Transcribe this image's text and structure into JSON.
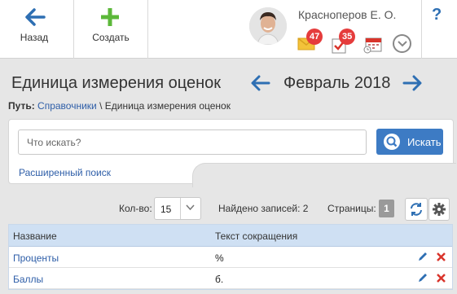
{
  "toolbar": {
    "back_label": "Назад",
    "create_label": "Создать",
    "back_icon": "arrow-left-icon",
    "create_icon": "plus-icon",
    "help_label": "?"
  },
  "user": {
    "name": "Красноперов Е. О.",
    "mail_count": "47",
    "task_count": "35"
  },
  "header": {
    "title": "Единица измерения оценок",
    "period": "Февраль 2018"
  },
  "breadcrumb": {
    "prefix": "Путь:",
    "link": "Справочники",
    "separator": " \\ ",
    "current": "Единица измерения оценок"
  },
  "search": {
    "placeholder": "Что искать?",
    "button_label": "Искать",
    "advanced_label": "Расширенный поиск"
  },
  "pager": {
    "count_label": "Кол-во:",
    "count_value": "15",
    "found_label": "Найдено записей:",
    "found_value": "2",
    "pages_label": "Страницы:",
    "page_current": "1"
  },
  "table": {
    "columns": [
      "Название",
      "Текст сокращения"
    ],
    "rows": [
      {
        "name": "Проценты",
        "abbr": "%"
      },
      {
        "name": "Баллы",
        "abbr": "б."
      }
    ]
  },
  "colors": {
    "accent_blue": "#2e6fb3",
    "create_green": "#5cb83a",
    "badge_red": "#e53c3c",
    "table_header": "#cfe0f3",
    "delete_red": "#d9342b"
  }
}
